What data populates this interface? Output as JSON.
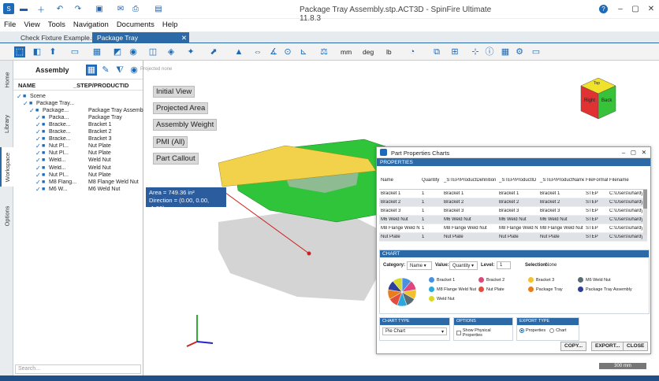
{
  "window": {
    "title": "Package Tray Assembly.stp.ACT3D - SpinFire Ultimate 11.8.3"
  },
  "menu": [
    "File",
    "View",
    "Tools",
    "Navigation",
    "Documents",
    "Help"
  ],
  "tabs": [
    "Check Fixture Example.stp",
    "Package Tray Assembly.stp.ACT3D"
  ],
  "toolbar": {
    "units": [
      "mm",
      "deg",
      "lb"
    ]
  },
  "side_tabs": [
    "Home",
    "Library",
    "Workspace",
    "Options"
  ],
  "assembly": {
    "title": "Assembly",
    "col_name": "NAME",
    "col_product": "_STEP/PRODUCTID",
    "tree": [
      {
        "name": "Scene",
        "id": ""
      },
      {
        "name": "Package Tray...",
        "id": ""
      },
      {
        "name": "Package...",
        "id": "Package Tray Assembly"
      },
      {
        "name": "Packa...",
        "id": "Package Tray"
      },
      {
        "name": "Bracke...",
        "id": "Bracket 1"
      },
      {
        "name": "Bracke...",
        "id": "Bracket 2"
      },
      {
        "name": "Bracke...",
        "id": "Bracket 3"
      },
      {
        "name": "Nut Pl...",
        "id": "Nut Plate"
      },
      {
        "name": "Nut Pl...",
        "id": "Nut Plate"
      },
      {
        "name": "Weld...",
        "id": "Weld Nut"
      },
      {
        "name": "Weld...",
        "id": "Weld Nut"
      },
      {
        "name": "Nut Pl...",
        "id": "Nut Plate"
      },
      {
        "name": "M8 Flang...",
        "id": "M8 Flange Weld Nut"
      },
      {
        "name": "M6 W...",
        "id": "M6 Weld Nut"
      }
    ],
    "search_placeholder": "Search..."
  },
  "viewport": {
    "label": "Projected none",
    "buttons": [
      "Initial View",
      "Projected Area",
      "Assembly Weight",
      "PMI (All)",
      "Part Callout"
    ],
    "tooltip_area": "Area = 749.36 in²",
    "tooltip_direction": "Direction = (0.00, 0.00, -1.00)",
    "cube_faces": [
      "Top",
      "Right",
      "Back"
    ],
    "scale": "300 mm"
  },
  "part_properties": {
    "title": "Part Properties Charts",
    "properties_label": "PROPERTIES",
    "columns": [
      "Name",
      "Quantity",
      "_STEP/ProductDefinition",
      "_STEP/ProductID",
      "_STEP/ProductName",
      "FileFormat",
      "Filename"
    ],
    "rows": [
      [
        "Bracket 1",
        "1",
        "Bracket 1",
        "Bracket 1",
        "Bracket 1",
        "STEP",
        "C:\\Users\\uhardy\\D"
      ],
      [
        "Bracket 2",
        "1",
        "Bracket 2",
        "Bracket 2",
        "Bracket 2",
        "STEP",
        "C:\\Users\\uhardy\\D"
      ],
      [
        "Bracket 3",
        "1",
        "Bracket 3",
        "Bracket 3",
        "Bracket 3",
        "STEP",
        "C:\\Users\\uhardy\\D"
      ],
      [
        "M6 Weld Nut",
        "1",
        "M6 Weld Nut",
        "M6 Weld Nut",
        "M6 Weld Nut",
        "STEP",
        "C:\\Users\\uhardy\\D"
      ],
      [
        "M8 Flange Weld Nut",
        "1",
        "M8 Flange Weld Nut",
        "M8 Flange Weld Nut",
        "M8 Flange Weld Nut",
        "STEP",
        "C:\\Users\\uhardy\\D"
      ],
      [
        "Nut Plate",
        "1",
        "Nut Plate",
        "Nut Plate",
        "Nut Plate",
        "STEP",
        "C:\\Users\\uhardy\\D"
      ]
    ],
    "chart_label": "CHART",
    "category_label": "Category:",
    "category_value": "Name",
    "value_label": "Value:",
    "value_value": "Quantity",
    "level_label": "Level:",
    "level_value": "1",
    "selection_label": "Selection:",
    "selection_value": "None",
    "legend": [
      {
        "name": "Bracket 1",
        "color": "#4a90e2"
      },
      {
        "name": "Bracket 2",
        "color": "#e0457b"
      },
      {
        "name": "Bracket 3",
        "color": "#f2c12e"
      },
      {
        "name": "M6 Weld Nut",
        "color": "#5a6b74"
      },
      {
        "name": "M8 Flange Weld Nut",
        "color": "#29a8d9"
      },
      {
        "name": "Nut Plate",
        "color": "#e34d3d"
      },
      {
        "name": "Package Tray",
        "color": "#e87d1e"
      },
      {
        "name": "Package Tray Assembly",
        "color": "#2d3e9c"
      },
      {
        "name": "Weld Nut",
        "color": "#d7d92a"
      }
    ],
    "chart_type_label": "CHART TYPE",
    "chart_type_value": "Pie Chart",
    "options_label": "OPTIONS",
    "show_physical": "Show Physical Properties",
    "export_type_label": "EXPORT TYPE",
    "export_properties": "Properties",
    "export_chart": "Chart",
    "copy_btn": "COPY...",
    "export_btn": "EXPORT...",
    "close_btn": "CLOSE"
  },
  "chart_data": {
    "type": "pie",
    "categories": [
      "Bracket 1",
      "Bracket 2",
      "Bracket 3",
      "M6 Weld Nut",
      "M8 Flange Weld Nut",
      "Nut Plate",
      "Package Tray",
      "Package Tray Assembly",
      "Weld Nut"
    ],
    "values": [
      1,
      1,
      1,
      1,
      1,
      1,
      1,
      1,
      1
    ],
    "colors": [
      "#4a90e2",
      "#e0457b",
      "#f2c12e",
      "#5a6b74",
      "#29a8d9",
      "#e34d3d",
      "#e87d1e",
      "#2d3e9c",
      "#d7d92a"
    ]
  }
}
